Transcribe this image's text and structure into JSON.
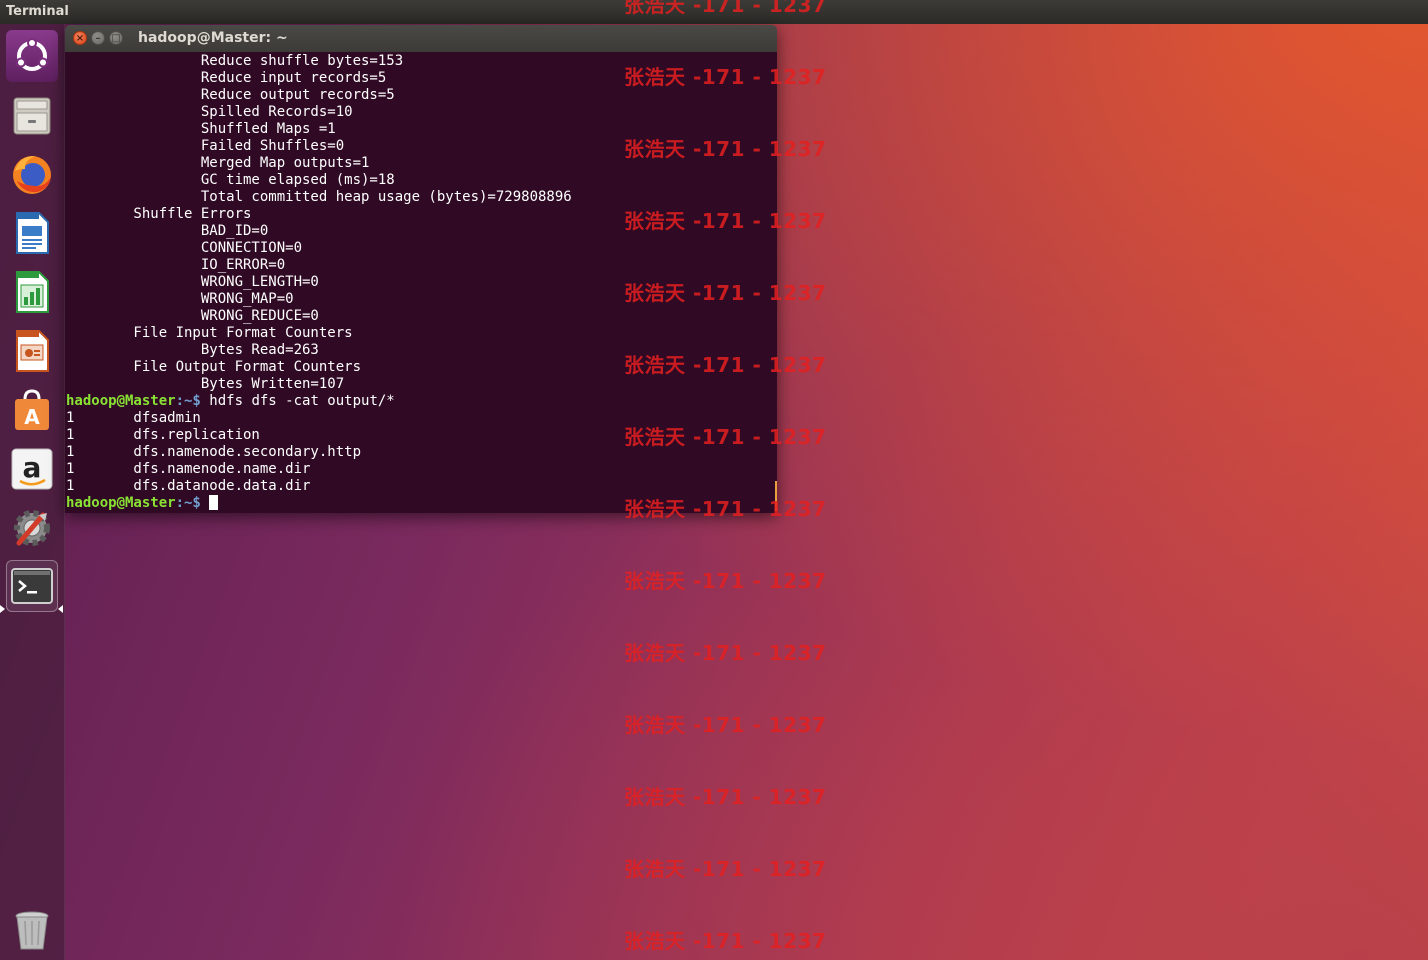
{
  "top_panel": {
    "app_title": "Terminal"
  },
  "launcher": {
    "items": [
      {
        "name": "Ubuntu Dash",
        "icon": "ubuntu-logo-icon"
      },
      {
        "name": "Files",
        "icon": "file-cabinet-icon"
      },
      {
        "name": "Firefox",
        "icon": "firefox-icon"
      },
      {
        "name": "LibreOffice Writer",
        "icon": "writer-document-icon"
      },
      {
        "name": "LibreOffice Calc",
        "icon": "calc-spreadsheet-icon"
      },
      {
        "name": "LibreOffice Impress",
        "icon": "impress-presentation-icon"
      },
      {
        "name": "Ubuntu Software",
        "icon": "software-bag-icon"
      },
      {
        "name": "Amazon",
        "icon": "amazon-icon"
      },
      {
        "name": "System Settings",
        "icon": "settings-gear-icon"
      },
      {
        "name": "Terminal",
        "icon": "terminal-icon"
      },
      {
        "name": "Trash",
        "icon": "trash-icon"
      }
    ]
  },
  "terminal": {
    "title": "hadoop@Master: ~",
    "lines": [
      "                Reduce shuffle bytes=153",
      "                Reduce input records=5",
      "                Reduce output records=5",
      "                Spilled Records=10",
      "                Shuffled Maps =1",
      "                Failed Shuffles=0",
      "                Merged Map outputs=1",
      "                GC time elapsed (ms)=18",
      "                Total committed heap usage (bytes)=729808896",
      "        Shuffle Errors",
      "                BAD_ID=0",
      "                CONNECTION=0",
      "                IO_ERROR=0",
      "                WRONG_LENGTH=0",
      "                WRONG_MAP=0",
      "                WRONG_REDUCE=0",
      "        File Input Format Counters",
      "                Bytes Read=263",
      "        File Output Format Counters",
      "                Bytes Written=107"
    ],
    "prompt_user": "hadoop@Master",
    "prompt_path": ":~$",
    "command": " hdfs dfs -cat output/*",
    "output": [
      "1       dfsadmin",
      "1       dfs.replication",
      "1       dfs.namenode.secondary.http",
      "1       dfs.namenode.name.dir",
      "1       dfs.datanode.data.dir"
    ]
  },
  "watermark": {
    "text": "张浩天 -171 - 1237",
    "color": "#e42020"
  },
  "colors": {
    "terminal_bg": "#300a24",
    "prompt_user": "#8ae234",
    "prompt_path": "#729fcf",
    "panel_bg": "#3c3b37"
  }
}
